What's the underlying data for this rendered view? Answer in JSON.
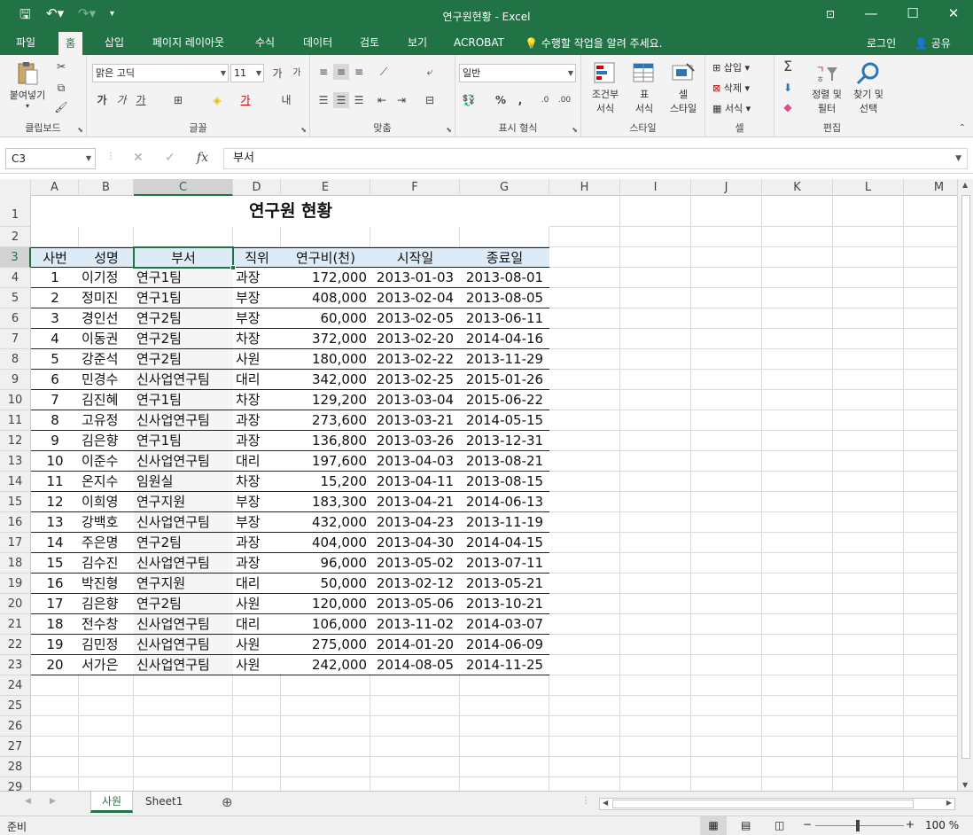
{
  "window": {
    "title": "연구원현황 - Excel"
  },
  "ribbon_tabs": [
    "파일",
    "홈",
    "삽입",
    "페이지 레이아웃",
    "수식",
    "데이터",
    "검토",
    "보기",
    "ACROBAT"
  ],
  "active_tab": "홈",
  "tell_me": "수행할 작업을 알려 주세요.",
  "login": "로그인",
  "share": "공유",
  "ribbon": {
    "clipboard": {
      "label": "클립보드",
      "paste": "붙여넣기"
    },
    "font": {
      "label": "글꼴",
      "name": "맑은 고딕",
      "size": "11"
    },
    "align": {
      "label": "맞춤"
    },
    "number": {
      "label": "표시 형식",
      "format": "일반"
    },
    "styles": {
      "label": "스타일",
      "cond1": "조건부",
      "cond2": "서식",
      "table1": "표",
      "table2": "서식",
      "cell1": "셀",
      "cell2": "스타일"
    },
    "cells": {
      "label": "셀",
      "insert": "삽입",
      "delete": "삭제",
      "format": "서식"
    },
    "editing": {
      "label": "편집",
      "sort1": "정렬 및",
      "sort2": "필터",
      "find1": "찾기 및",
      "find2": "선택"
    }
  },
  "formula_bar": {
    "name_box": "C3",
    "value": "부서"
  },
  "columns": [
    "A",
    "B",
    "C",
    "D",
    "E",
    "F",
    "G",
    "H",
    "I",
    "J",
    "K",
    "L",
    "M"
  ],
  "rows": [
    "1",
    "2",
    "3",
    "4",
    "5",
    "6",
    "7",
    "8",
    "9",
    "10",
    "11",
    "12",
    "13",
    "14",
    "15",
    "16",
    "17",
    "18",
    "19",
    "20",
    "21",
    "22",
    "23",
    "24",
    "25",
    "26",
    "27",
    "28",
    "29"
  ],
  "sheet": {
    "title": "연구원 현황",
    "headers": [
      "사번",
      "성명",
      "부서",
      "직위",
      "연구비(천)",
      "시작일",
      "종료일"
    ],
    "records": [
      [
        "1",
        "이기정",
        "연구1팀",
        "과장",
        "172,000",
        "2013-01-03",
        "2013-08-01"
      ],
      [
        "2",
        "정미진",
        "연구1팀",
        "부장",
        "408,000",
        "2013-02-04",
        "2013-08-05"
      ],
      [
        "3",
        "경인선",
        "연구2팀",
        "부장",
        "60,000",
        "2013-02-05",
        "2013-06-11"
      ],
      [
        "4",
        "이동권",
        "연구2팀",
        "차장",
        "372,000",
        "2013-02-20",
        "2014-04-16"
      ],
      [
        "5",
        "강준석",
        "연구2팀",
        "사원",
        "180,000",
        "2013-02-22",
        "2013-11-29"
      ],
      [
        "6",
        "민경수",
        "신사업연구팀",
        "대리",
        "342,000",
        "2013-02-25",
        "2015-01-26"
      ],
      [
        "7",
        "김진혜",
        "연구1팀",
        "차장",
        "129,200",
        "2013-03-04",
        "2015-06-22"
      ],
      [
        "8",
        "고유정",
        "신사업연구팀",
        "과장",
        "273,600",
        "2013-03-21",
        "2014-05-15"
      ],
      [
        "9",
        "김은향",
        "연구1팀",
        "과장",
        "136,800",
        "2013-03-26",
        "2013-12-31"
      ],
      [
        "10",
        "이준수",
        "신사업연구팀",
        "대리",
        "197,600",
        "2013-04-03",
        "2013-08-21"
      ],
      [
        "11",
        "온지수",
        "임원실",
        "차장",
        "15,200",
        "2013-04-11",
        "2013-08-15"
      ],
      [
        "12",
        "이희영",
        "연구지원",
        "부장",
        "183,300",
        "2013-04-21",
        "2014-06-13"
      ],
      [
        "13",
        "강백호",
        "신사업연구팀",
        "부장",
        "432,000",
        "2013-04-23",
        "2013-11-19"
      ],
      [
        "14",
        "주은명",
        "연구2팀",
        "과장",
        "404,000",
        "2013-04-30",
        "2014-04-15"
      ],
      [
        "15",
        "김수진",
        "신사업연구팀",
        "과장",
        "96,000",
        "2013-05-02",
        "2013-07-11"
      ],
      [
        "16",
        "박진형",
        "연구지원",
        "대리",
        "50,000",
        "2013-02-12",
        "2013-05-21"
      ],
      [
        "17",
        "김은향",
        "연구2팀",
        "사원",
        "120,000",
        "2013-05-06",
        "2013-10-21"
      ],
      [
        "18",
        "전수창",
        "신사업연구팀",
        "대리",
        "106,000",
        "2013-11-02",
        "2014-03-07"
      ],
      [
        "19",
        "김민정",
        "신사업연구팀",
        "사원",
        "275,000",
        "2014-01-20",
        "2014-06-09"
      ],
      [
        "20",
        "서가은",
        "신사업연구팀",
        "사원",
        "242,000",
        "2014-08-05",
        "2014-11-25"
      ]
    ]
  },
  "sheet_tabs": [
    "사원",
    "Sheet1"
  ],
  "active_sheet": "사원",
  "status": {
    "ready": "준비",
    "zoom": "100 %"
  },
  "colors": {
    "excel_green": "#217346",
    "header_fill": "#ddebf7"
  }
}
